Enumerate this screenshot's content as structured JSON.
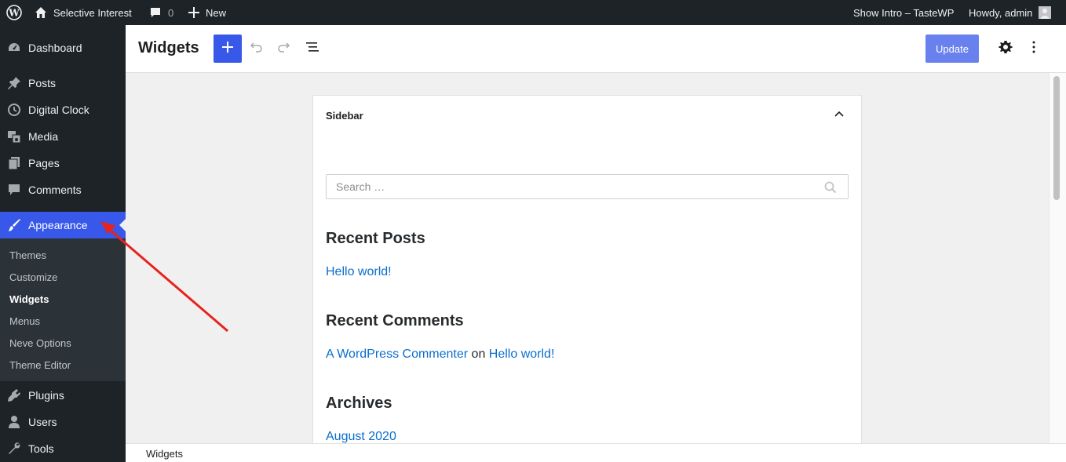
{
  "admin_bar": {
    "site_name": "Selective Interest",
    "comments_count": "0",
    "new_label": "New",
    "show_intro": "Show Intro – TasteWP",
    "howdy": "Howdy, admin"
  },
  "menu": {
    "items": [
      {
        "label": "Dashboard",
        "icon": "dashboard-icon"
      },
      {
        "label": "Posts",
        "icon": "pin-icon"
      },
      {
        "label": "Digital Clock",
        "icon": "clock-icon"
      },
      {
        "label": "Media",
        "icon": "media-icon"
      },
      {
        "label": "Pages",
        "icon": "pages-icon"
      },
      {
        "label": "Comments",
        "icon": "comment-icon"
      },
      {
        "label": "Appearance",
        "icon": "brush-icon"
      },
      {
        "label": "Plugins",
        "icon": "plugin-icon"
      },
      {
        "label": "Users",
        "icon": "user-icon"
      },
      {
        "label": "Tools",
        "icon": "wrench-icon"
      }
    ],
    "submenu": [
      "Themes",
      "Customize",
      "Widgets",
      "Menus",
      "Neve Options",
      "Theme Editor"
    ]
  },
  "header": {
    "title": "Widgets",
    "update_label": "Update"
  },
  "sidebar_area": {
    "title": "Sidebar",
    "search_placeholder": "Search …",
    "recent_posts_heading": "Recent Posts",
    "recent_post_link": "Hello world!",
    "recent_comments_heading": "Recent Comments",
    "commenter_link": "A WordPress Commenter",
    "on_text": "on",
    "comment_post_link": "Hello world!",
    "archives_heading": "Archives",
    "archive_link": "August 2020"
  },
  "footer": {
    "breadcrumb": "Widgets"
  },
  "colors": {
    "admin_dark": "#1d2327",
    "accent_blue": "#3858e9",
    "link_blue": "#0b6ecf",
    "annotation_red": "#e8221c"
  }
}
